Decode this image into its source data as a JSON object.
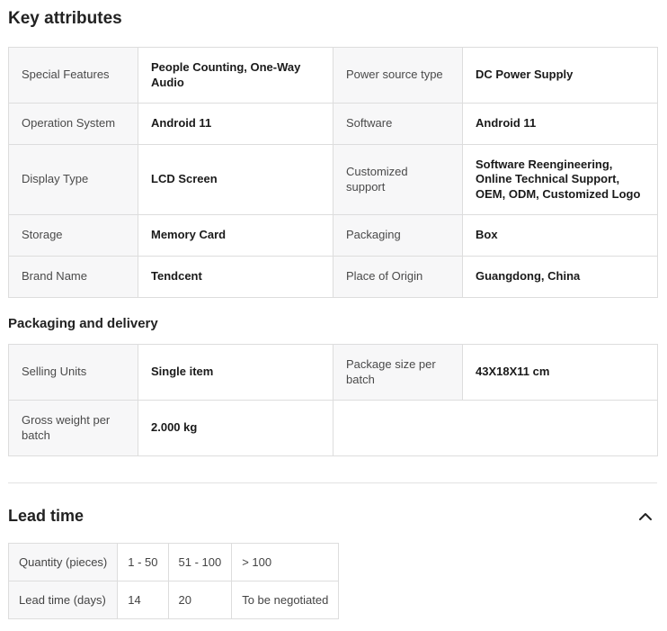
{
  "key_attributes": {
    "title": "Key attributes",
    "rows": [
      [
        {
          "label": "Special Features",
          "value": "People Counting, One-Way Audio"
        },
        {
          "label": "Power source type",
          "value": "DC Power Supply"
        }
      ],
      [
        {
          "label": "Operation System",
          "value": "Android 11"
        },
        {
          "label": "Software",
          "value": "Android 11"
        }
      ],
      [
        {
          "label": "Display Type",
          "value": "LCD Screen"
        },
        {
          "label": "Customized support",
          "value": "Software Reengineering, Online Technical Support, OEM, ODM, Customized Logo"
        }
      ],
      [
        {
          "label": "Storage",
          "value": "Memory Card"
        },
        {
          "label": "Packaging",
          "value": "Box"
        }
      ],
      [
        {
          "label": "Brand Name",
          "value": "Tendcent"
        },
        {
          "label": "Place of Origin",
          "value": "Guangdong, China"
        }
      ]
    ]
  },
  "packaging": {
    "title": "Packaging and delivery",
    "rows": [
      [
        {
          "label": "Selling Units",
          "value": "Single item"
        },
        {
          "label": "Package size per batch",
          "value": "43X18X11 cm"
        }
      ],
      [
        {
          "label": "Gross weight per batch",
          "value": "2.000 kg"
        }
      ]
    ]
  },
  "lead_time": {
    "title": "Lead time",
    "toggle_icon": "chevron-up-icon",
    "quantity_label": "Quantity (pieces)",
    "lead_label": "Lead time (days)",
    "quantities": [
      "1 - 50",
      "51 - 100",
      "> 100"
    ],
    "days": [
      "14",
      "20",
      "To be negotiated"
    ]
  }
}
